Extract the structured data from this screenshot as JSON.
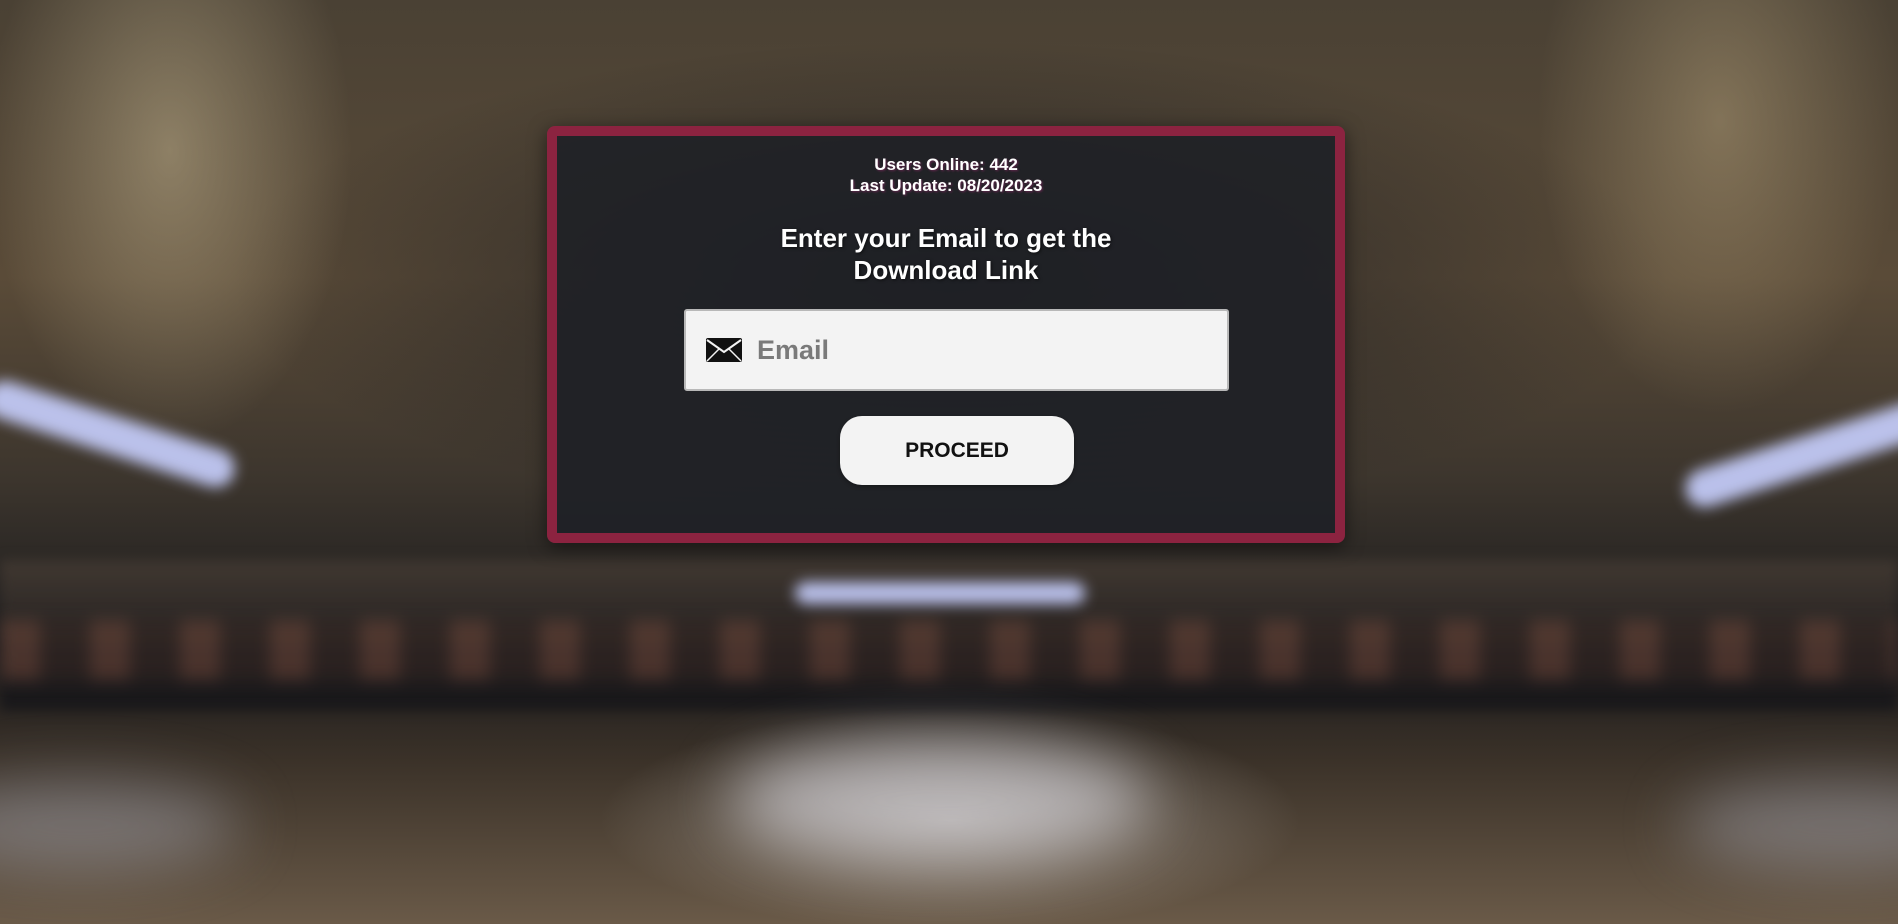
{
  "stats": {
    "users_online": "Users Online: 442",
    "last_update": "Last Update: 08/20/2023"
  },
  "form": {
    "headline_line1": "Enter your Email to get the",
    "headline_line2": "Download Link",
    "email_placeholder": "Email",
    "email_value": "",
    "email_icon": "envelope-icon",
    "proceed_label": "PROCEED"
  },
  "colors": {
    "card_border": "#8c2340",
    "card_background": "#1e2026",
    "input_background": "#f3f3f3",
    "button_background": "#f3f3f3"
  }
}
